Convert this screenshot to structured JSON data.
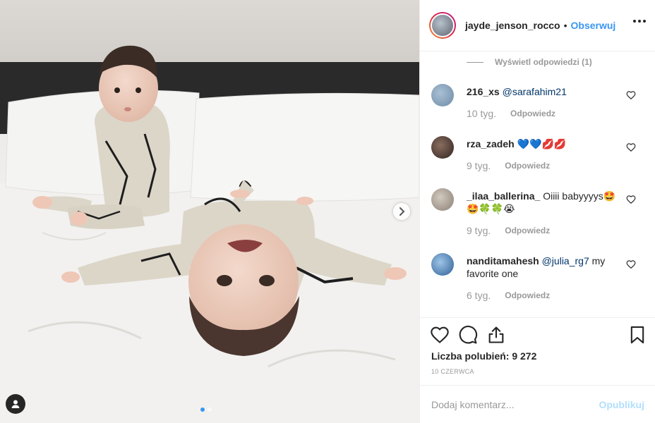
{
  "post": {
    "username": "jayde_jenson_rocco",
    "separator": "•",
    "follow_label": "Obserwuj",
    "likes_text": "Liczba polubień: 9 272",
    "date": "10 czerwca"
  },
  "view_replies": "Wyświetl odpowiedzi (1)",
  "comments": [
    {
      "username": "216_xs",
      "mention": "@sarafahim21",
      "text": "",
      "time": "10 tyg.",
      "reply_label": "Odpowiedz",
      "avatar_color": "#7f9bb3"
    },
    {
      "username": "rza_zadeh",
      "mention": "",
      "text": "💙💙💋💋",
      "time": "9 tyg.",
      "reply_label": "Odpowiedz",
      "avatar_color": "#4a3b35"
    },
    {
      "username": "_ilaa_ballerina_",
      "mention": "",
      "text": "Oiiii babyyyys🤩🤩🍀🍀😭",
      "time": "9 tyg.",
      "reply_label": "Odpowiedz",
      "avatar_color": "#a39a8f"
    },
    {
      "username": "nanditamahesh",
      "mention": "@julia_rg7",
      "text": "my favorite one",
      "time": "6 tyg.",
      "reply_label": "Odpowiedz",
      "avatar_color": "#3f6fa8"
    }
  ],
  "add_comment": {
    "placeholder": "Dodaj komentarz...",
    "publish_label": "Opublikuj"
  },
  "colors": {
    "link_blue": "#3897f0",
    "publish_disabled": "#b2dffc",
    "secondary_text": "#999999",
    "mention": "#003569"
  },
  "carousel": {
    "total": 2,
    "current": 1
  }
}
